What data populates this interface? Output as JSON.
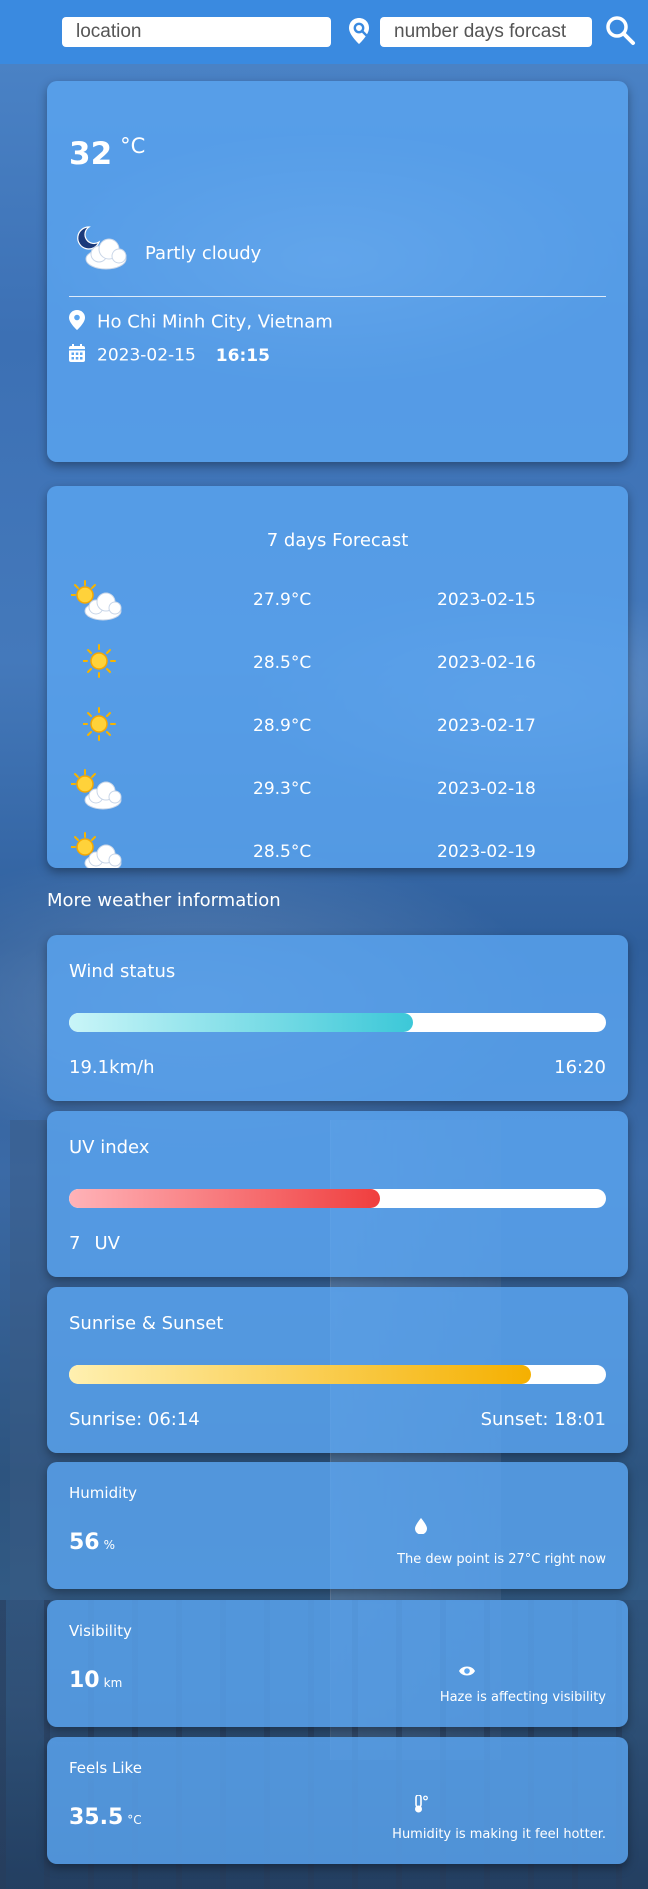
{
  "header": {
    "location_placeholder": "location",
    "days_placeholder": "number days forcast",
    "pin_icon": "map-pin-search-icon",
    "search_icon": "search-icon"
  },
  "current": {
    "temperature": "32",
    "unit": "°C",
    "condition": "Partly cloudy",
    "condition_icon": "night-partly-cloudy-icon",
    "location": "Ho Chi Minh City, Vietnam",
    "date": "2023-02-15",
    "time": "16:15"
  },
  "forecast": {
    "title": "7 days Forecast",
    "days": [
      {
        "icon": "partly-cloudy-icon",
        "temp": "27.9°C",
        "date": "2023-02-15"
      },
      {
        "icon": "sunny-icon",
        "temp": "28.5°C",
        "date": "2023-02-16"
      },
      {
        "icon": "sunny-icon",
        "temp": "28.9°C",
        "date": "2023-02-17"
      },
      {
        "icon": "partly-cloudy-icon",
        "temp": "29.3°C",
        "date": "2023-02-18"
      },
      {
        "icon": "partly-cloudy-icon",
        "temp": "28.5°C",
        "date": "2023-02-19"
      }
    ]
  },
  "more_info": {
    "label": "More weather information"
  },
  "wind": {
    "title": "Wind status",
    "speed": "19.1km/h",
    "time": "16:20",
    "level": 0.64,
    "colors": [
      "#c9f5f8",
      "#3cc8d8"
    ]
  },
  "uv": {
    "title": "UV index",
    "value": "7",
    "unit": "UV",
    "level": 0.58,
    "colors": [
      "#ffb3b8",
      "#f03e3e"
    ]
  },
  "sun": {
    "title": "Sunrise & Sunset",
    "sunrise": "Sunrise: 06:14",
    "sunset": "Sunset: 18:01",
    "level": 0.86,
    "colors": [
      "#fff0b0",
      "#f5b000"
    ]
  },
  "humidity": {
    "title": "Humidity",
    "value": "56",
    "unit": "%",
    "note": "The dew point is 27°C right now",
    "icon": "water-drop-icon"
  },
  "visibility": {
    "title": "Visibility",
    "value": "10",
    "unit": "km",
    "note": "Haze is affecting visibility",
    "icon": "eye-icon"
  },
  "feels_like": {
    "title": "Feels Like",
    "value": "35.5",
    "unit": "°C",
    "note": "Humidity is making it feel hotter.",
    "icon": "thermometer-icon"
  }
}
